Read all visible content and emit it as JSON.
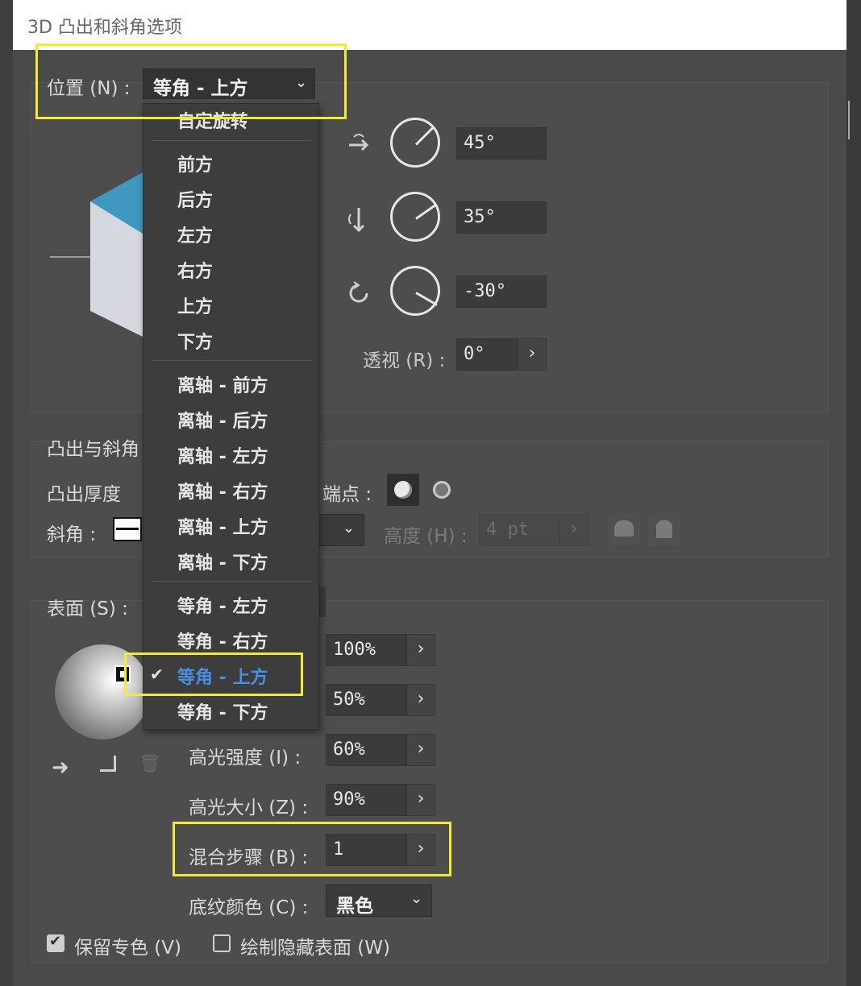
{
  "window": {
    "title": "3D 凸出和斜角选项"
  },
  "position": {
    "label": "位置 (N) :",
    "selected": "等角 - 上方",
    "menu": {
      "custom": "自定旋转",
      "group1": [
        "前方",
        "后方",
        "左方",
        "右方",
        "上方",
        "下方"
      ],
      "group2": [
        "离轴 - 前方",
        "离轴 - 后方",
        "离轴 - 左方",
        "离轴 - 右方",
        "离轴 - 上方",
        "离轴 - 下方"
      ],
      "group3": [
        "等角 - 左方",
        "等角 - 右方",
        "等角 - 上方",
        "等角 - 下方"
      ],
      "checkmark": "✔"
    }
  },
  "rotation": {
    "x": {
      "value": "45°",
      "degrees": 45
    },
    "y": {
      "value": "35°",
      "degrees": 35
    },
    "z": {
      "value": "-30°",
      "degrees": -30
    },
    "perspective_label": "透视 (R) :",
    "perspective_value": "0°"
  },
  "extrude": {
    "section_label": "凸出与斜角",
    "depth_label": "凸出厚度",
    "cap_label": "端点 :",
    "bevel_label": "斜角 :",
    "height_label": "高度 (H) :",
    "height_value": "4 pt"
  },
  "surface": {
    "label": "表面 (S) :",
    "light_intensity": "100%",
    "ambient_light": "50%",
    "highlight_intensity_label": "高光强度 (I) :",
    "highlight_intensity": "60%",
    "highlight_size_label": "高光大小 (Z) :",
    "highlight_size": "90%",
    "blend_steps_label": "混合步骤 (B) :",
    "blend_steps": "1",
    "shade_color_label": "底纹颜色 (C) :",
    "shade_color": "黑色"
  },
  "options": {
    "preserve_spot": {
      "label": "保留专色 (V)",
      "checked": true
    },
    "draw_hidden": {
      "label": "绘制隐藏表面 (W)",
      "checked": false
    }
  },
  "colors": {
    "highlight": "#f2ea33",
    "selected_item": "#4a90e2",
    "cube_top": "#3f98c0"
  }
}
